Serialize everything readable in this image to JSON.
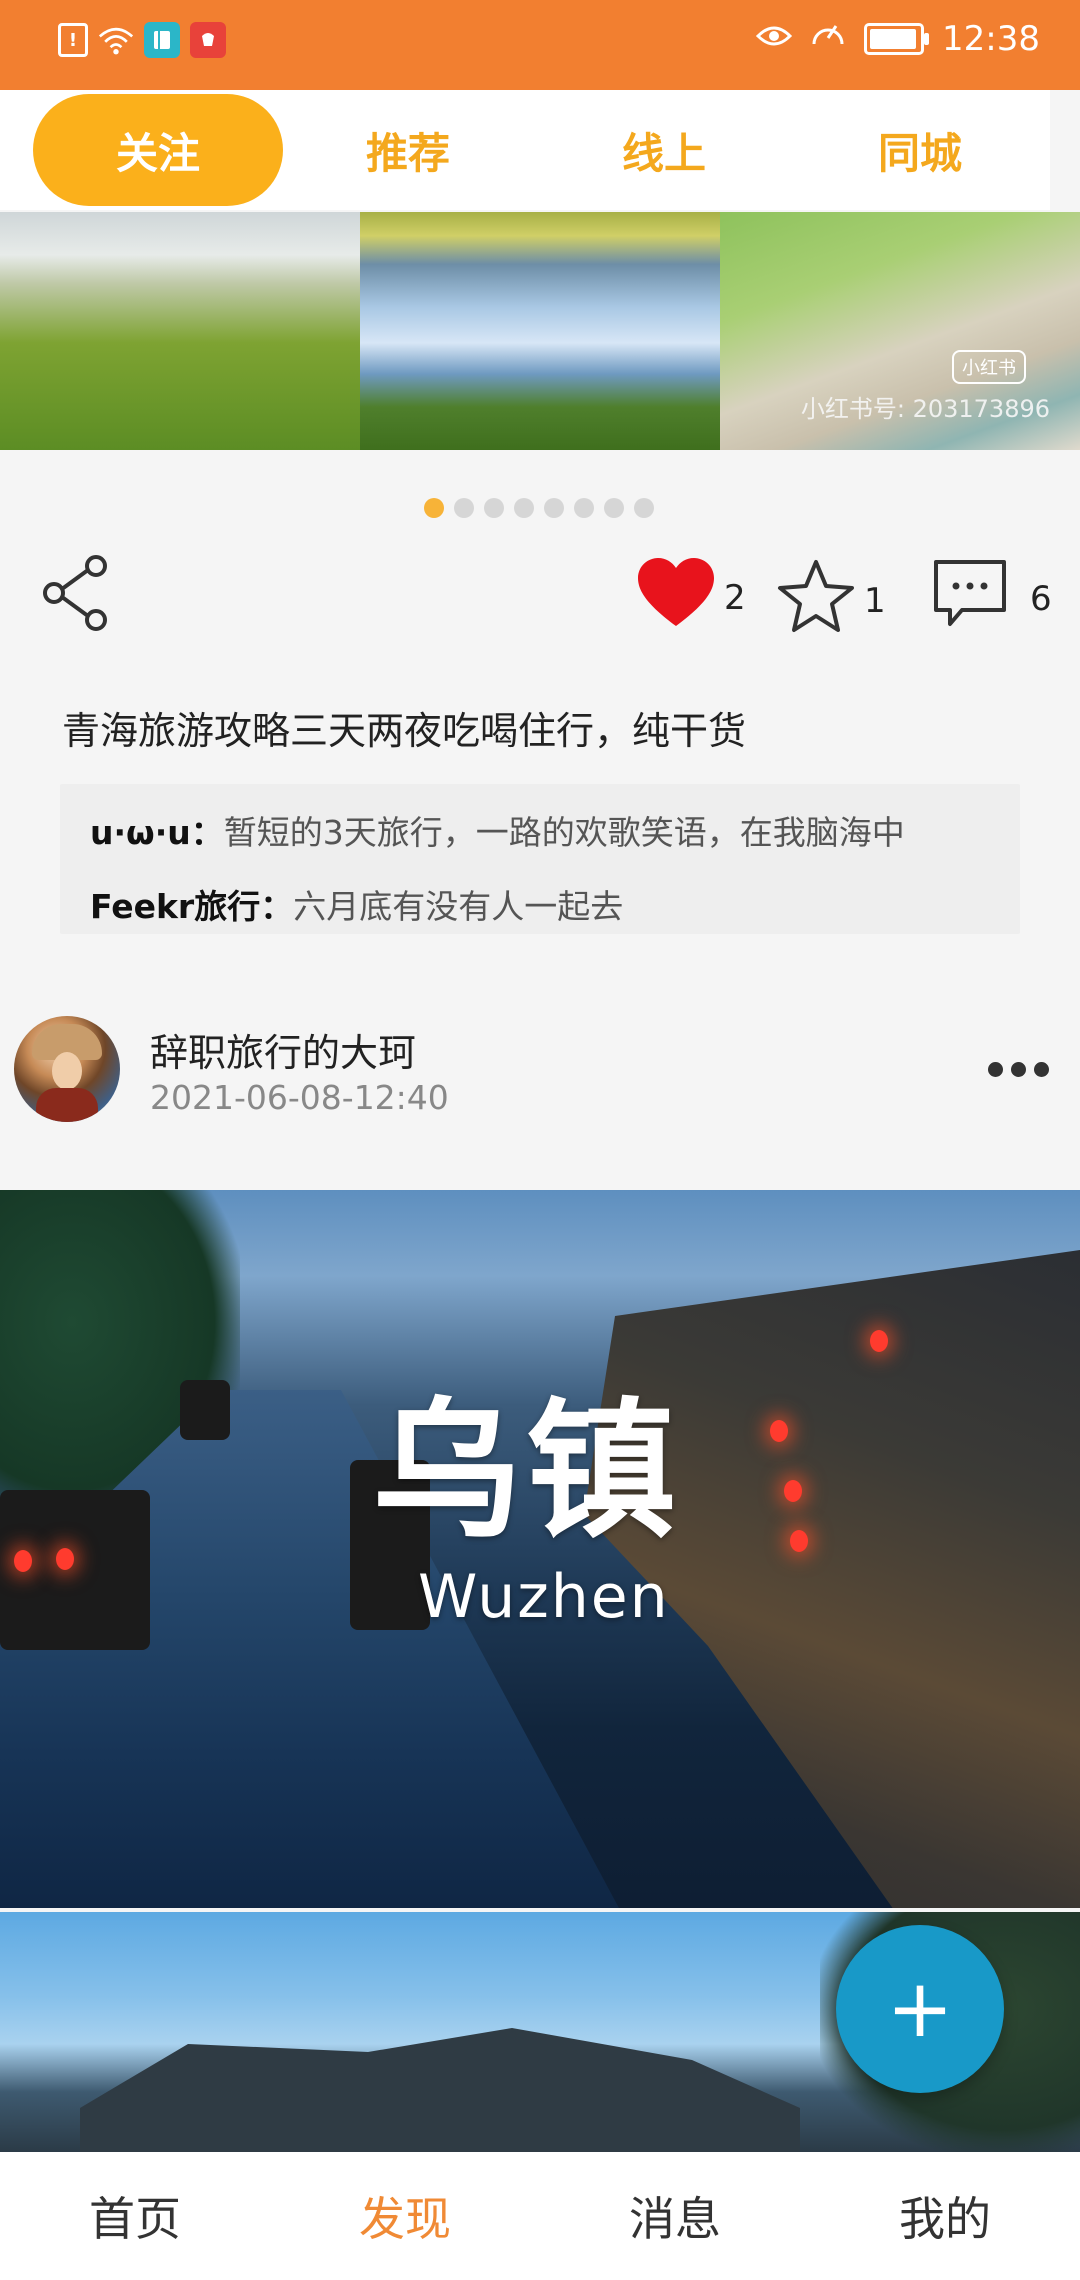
{
  "status_bar": {
    "time": "12:38",
    "left_icons": [
      "alert-icon",
      "wifi-icon",
      "book-app-icon",
      "huawei-app-icon"
    ],
    "right_icons": [
      "eye-icon",
      "speed-icon",
      "battery-icon"
    ]
  },
  "tabs": [
    {
      "label": "关注",
      "active": true
    },
    {
      "label": "推荐",
      "active": false
    },
    {
      "label": "线上",
      "active": false
    },
    {
      "label": "同城",
      "active": false
    }
  ],
  "carousel": {
    "watermark": "小红书号: 203173896",
    "watermark_logo": "小红书",
    "dot_count": 8,
    "active_dot": 0
  },
  "actions": {
    "likes": "2",
    "favorites": "1",
    "comments": "6"
  },
  "post": {
    "title": "青海旅游攻略三天两夜吃喝住行，纯干货",
    "comments": [
      {
        "user": "u·ω·u：",
        "text": "暂短的3天旅行，一路的欢歌笑语，在我脑海中"
      },
      {
        "user": "Feekr旅行：",
        "text": "六月底有没有人一起去"
      }
    ]
  },
  "next_post": {
    "username": "辞职旅行的大珂",
    "timestamp": "2021-06-08-12:40",
    "image_title_cn": "乌镇",
    "image_title_en": "Wuzhen"
  },
  "fab_label": "+",
  "bottom_nav": [
    {
      "label": "首页",
      "active": false
    },
    {
      "label": "发现",
      "active": true
    },
    {
      "label": "消息",
      "active": false
    },
    {
      "label": "我的",
      "active": false
    }
  ],
  "colors": {
    "status_bar": "#f27f30",
    "tab_active": "#fbb01b",
    "tab_text": "#f4a81d",
    "like_red": "#e8131c",
    "fab": "#1899c8",
    "nav_active": "#f08a35"
  }
}
